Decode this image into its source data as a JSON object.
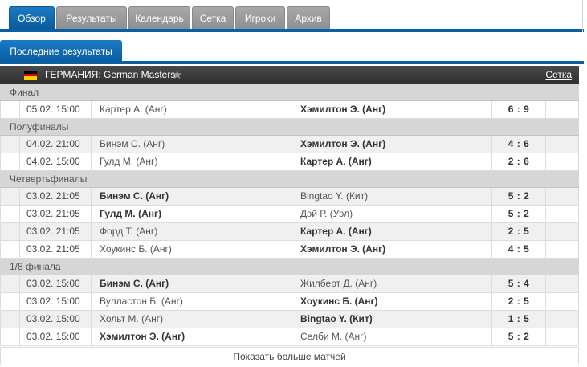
{
  "tabs": [
    {
      "label": "Обзор",
      "active": true
    },
    {
      "label": "Результаты",
      "active": false
    },
    {
      "label": "Календарь",
      "active": false
    },
    {
      "label": "Сетка",
      "active": false
    },
    {
      "label": "Игроки",
      "active": false
    },
    {
      "label": "Архив",
      "active": false
    }
  ],
  "subtab": {
    "label": "Последние результаты"
  },
  "league": {
    "country_flag": "germany-flag-icon",
    "name": "ГЕРМАНИЯ: German Masters",
    "favorite_icon": "star-icon",
    "link_label": "Сетка",
    "flag_colors": [
      "#000000",
      "#dd0000",
      "#ffce00"
    ]
  },
  "stages": [
    {
      "label": "Финал",
      "matches": [
        {
          "time": "05.02. 15:00",
          "home": "Картер А. (Анг)",
          "away": "Хэмилтон Э. (Анг)",
          "score": "6 : 9",
          "winner": "away"
        }
      ]
    },
    {
      "label": "Полуфиналы",
      "matches": [
        {
          "time": "04.02. 21:00",
          "home": "Бинэм С. (Анг)",
          "away": "Хэмилтон Э. (Анг)",
          "score": "4 : 6",
          "winner": "away"
        },
        {
          "time": "04.02. 15:00",
          "home": "Гулд М. (Анг)",
          "away": "Картер А. (Анг)",
          "score": "2 : 6",
          "winner": "away"
        }
      ]
    },
    {
      "label": "Четвертьфиналы",
      "matches": [
        {
          "time": "03.02. 21:05",
          "home": "Бинэм С. (Анг)",
          "away": "Bingtao Y. (Кит)",
          "score": "5 : 2",
          "winner": "home"
        },
        {
          "time": "03.02. 21:05",
          "home": "Гулд М. (Анг)",
          "away": "Дэй Р. (Уэл)",
          "score": "5 : 2",
          "winner": "home"
        },
        {
          "time": "03.02. 21:05",
          "home": "Форд Т. (Анг)",
          "away": "Картер А. (Анг)",
          "score": "2 : 5",
          "winner": "away"
        },
        {
          "time": "03.02. 21:05",
          "home": "Хоукинс Б. (Анг)",
          "away": "Хэмилтон Э. (Анг)",
          "score": "4 : 5",
          "winner": "away"
        }
      ]
    },
    {
      "label": "1/8 финала",
      "matches": [
        {
          "time": "03.02. 15:00",
          "home": "Бинэм С. (Анг)",
          "away": "Жилберт Д. (Анг)",
          "score": "5 : 4",
          "winner": "home"
        },
        {
          "time": "03.02. 15:00",
          "home": "Вулластон Б. (Анг)",
          "away": "Хоукинс Б. (Анг)",
          "score": "2 : 5",
          "winner": "away"
        },
        {
          "time": "03.02. 15:00",
          "home": "Хольт М. (Анг)",
          "away": "Bingtao Y. (Кит)",
          "score": "1 : 5",
          "winner": "away"
        },
        {
          "time": "03.02. 15:00",
          "home": "Хэмилтон Э. (Анг)",
          "away": "Селби М. (Анг)",
          "score": "5 : 2",
          "winner": "home"
        }
      ]
    }
  ],
  "show_more": {
    "label": "Показать больше матчей"
  }
}
